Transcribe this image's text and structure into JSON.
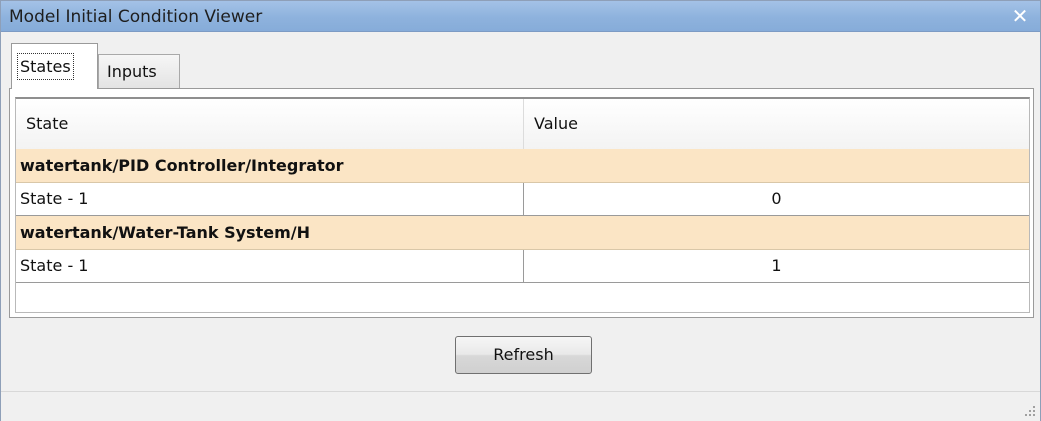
{
  "window": {
    "title": "Model Initial Condition Viewer",
    "close_icon": "close-icon",
    "close_glyph": "✕"
  },
  "tabs": [
    {
      "label": "States",
      "selected": true
    },
    {
      "label": "Inputs",
      "selected": false
    }
  ],
  "table": {
    "columns": [
      "State",
      "Value"
    ],
    "groups": [
      {
        "name": "watertank/PID Controller/Integrator",
        "rows": [
          {
            "state": "State - 1",
            "value": "0"
          }
        ]
      },
      {
        "name": "watertank/Water-Tank System/H",
        "rows": [
          {
            "state": "State - 1",
            "value": "1"
          }
        ]
      }
    ]
  },
  "buttons": {
    "refresh_label": "Refresh"
  },
  "colors": {
    "title_bar": "#8eb2dd",
    "group_row": "#fbe5c5",
    "window_bg": "#f0f0f0"
  },
  "icons": {
    "resize_grip": "resize-grip-icon"
  }
}
